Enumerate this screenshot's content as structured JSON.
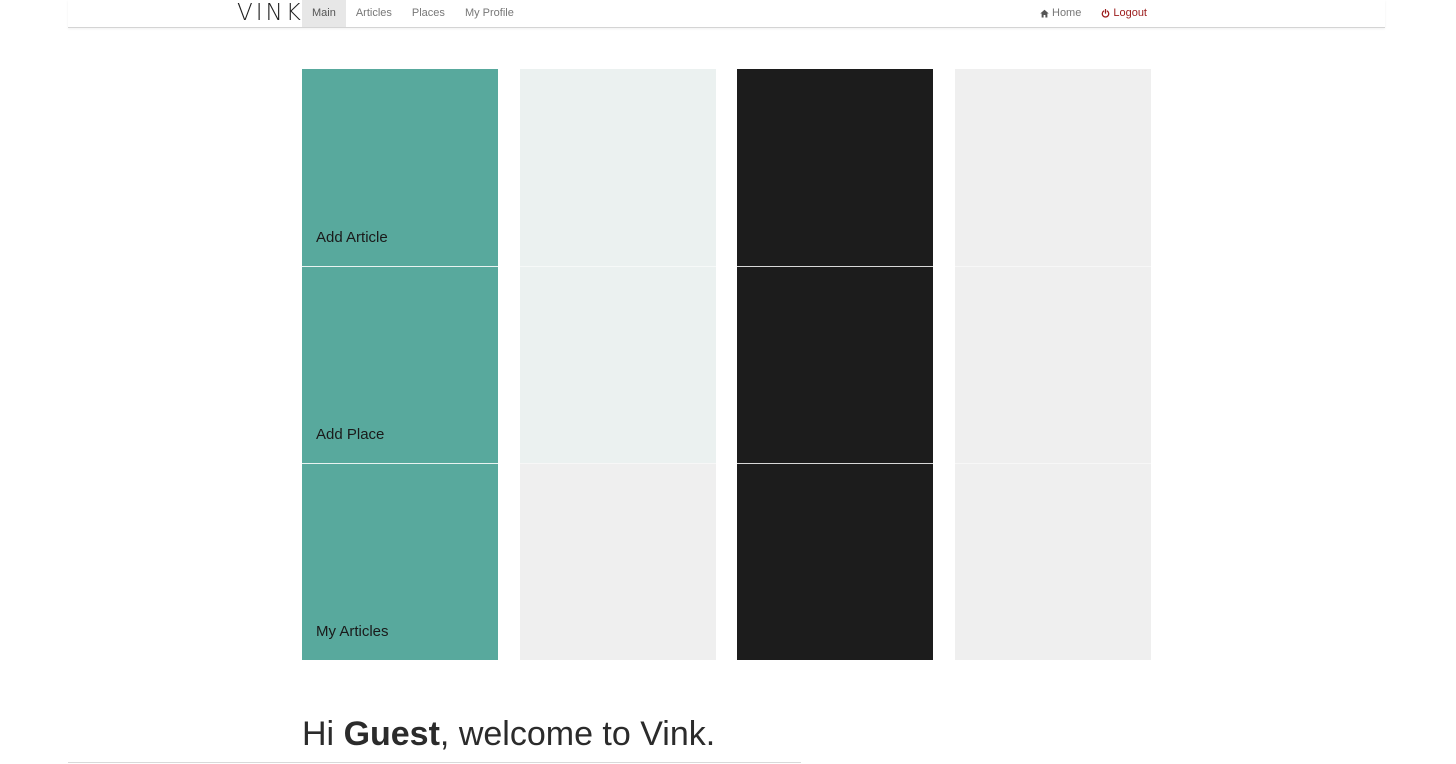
{
  "brand": {
    "name": "VINK"
  },
  "nav": {
    "left": [
      {
        "label": "Main"
      },
      {
        "label": "Articles"
      },
      {
        "label": "Places"
      },
      {
        "label": "My Profile"
      }
    ],
    "right": {
      "home_label": "Home",
      "logout_label": "Logout"
    }
  },
  "tiles": {
    "labels": [
      "Add Article",
      "Add Place",
      "My Articles"
    ],
    "colors": {
      "teal": "#58a99d",
      "mint": "#ebf1f0",
      "black": "#1c1c1c",
      "gray": "#efefef"
    }
  },
  "welcome": {
    "prefix": "Hi ",
    "name": "Guest",
    "suffix": ", welcome to Vink."
  },
  "colors": {
    "logout": "#9b1b1b",
    "active_tab_bg": "#e7e7e7"
  }
}
